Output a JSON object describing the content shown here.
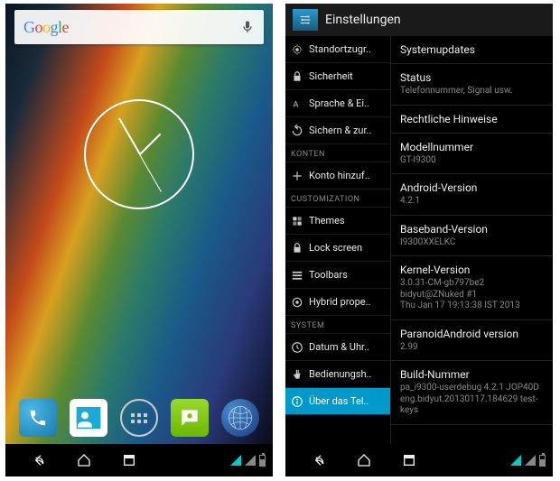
{
  "left": {
    "search_text": "Google",
    "dock": [
      "phone",
      "contacts",
      "apps",
      "messaging",
      "browser"
    ]
  },
  "right": {
    "header_title": "Einstellungen",
    "left_items": [
      {
        "icon": "location",
        "label": "Standortzugr.."
      },
      {
        "icon": "lock",
        "label": "Sicherheit"
      },
      {
        "icon": "lang",
        "label": "Sprache & Ei.."
      },
      {
        "icon": "backup",
        "label": "Sichern & zur.."
      }
    ],
    "section_accounts": "KONTEN",
    "add_account": "Konto hinzuf..",
    "section_custom": "CUSTOMIZATION",
    "custom_items": [
      {
        "icon": "themes",
        "label": "Themes"
      },
      {
        "icon": "lock",
        "label": "Lock screen"
      },
      {
        "icon": "toolbars",
        "label": "Toolbars"
      },
      {
        "icon": "hybrid",
        "label": "Hybrid prope.."
      }
    ],
    "section_system": "SYSTEM",
    "system_items": [
      {
        "icon": "clock",
        "label": "Datum & Uhr.."
      },
      {
        "icon": "a11y",
        "label": "Bedienungsh.."
      },
      {
        "icon": "info",
        "label": "Über das Tel.."
      }
    ],
    "details": [
      {
        "title": "Systemupdates",
        "sub": ""
      },
      {
        "title": "Status",
        "sub": "Telefonnummer, Signal usw."
      },
      {
        "title": "Rechtliche Hinweise",
        "sub": ""
      },
      {
        "title": "Modellnummer",
        "sub": "GT-I9300"
      },
      {
        "title": "Android-Version",
        "sub": "4.2.1"
      },
      {
        "title": "Baseband-Version",
        "sub": "I9300XXELKC"
      },
      {
        "title": "Kernel-Version",
        "sub": "3.0.31-CM-gb797be2\nbidyut@ZNuked #1\nThu Jan 17 19:13:38 IST 2013"
      },
      {
        "title": "ParanoidAndroid version",
        "sub": "2.99"
      },
      {
        "title": "Build-Nummer",
        "sub": "pa_i9300-userdebug 4.2.1 JOP40D eng.bidyut.20130117.184629 test-keys"
      }
    ]
  },
  "colors": {
    "holo": "#0099cc"
  }
}
